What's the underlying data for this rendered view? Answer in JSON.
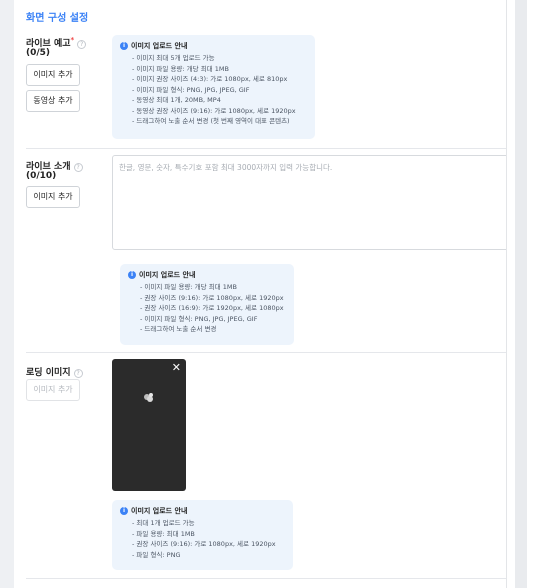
{
  "section_title": "화면 구성 설정",
  "live_preview": {
    "label": "라이브 예고",
    "required_mark": "*",
    "count": "(0/5)",
    "add_image_label": "이미지 추가",
    "add_video_label": "동영상 추가",
    "info": {
      "title": "이미지 업로드 안내",
      "items": [
        "이미지 최대 5개 업로드 가능",
        "이미지 파일 용량: 개당 최대 1MB",
        "이미지 권장 사이즈 (4:3): 가로 1080px, 세로 810px",
        "이미지 파일 형식: PNG, JPG, JPEG, GIF",
        "동영상 최대 1개, 20MB, MP4",
        "동영상 권장 사이즈 (9:16): 가로 1080px, 세로 1920px",
        "드래그하여 노출 순서 변경 (첫 번째 영역이 대표 콘텐츠)"
      ]
    }
  },
  "live_intro": {
    "label": "라이브 소개",
    "count": "(0/10)",
    "add_image_label": "이미지 추가",
    "textarea_placeholder": "한글, 영문, 숫자, 특수기호 포함 최대 3000자까지 입력 가능합니다.",
    "info": {
      "title": "이미지 업로드 안내",
      "items": [
        "이미지 파일 용량: 개당 최대 1MB",
        "권장 사이즈 (9:16): 가로 1080px, 세로 1920px",
        "권장 사이즈 (16:9): 가로 1920px, 세로 1080px",
        "이미지 파일 형식: PNG, JPG, JPEG, GIF",
        "드래그하여 노출 순서 변경"
      ]
    }
  },
  "loading_image": {
    "label": "로딩 이미지",
    "add_image_label": "이미지 추가",
    "close_symbol": "✕",
    "info": {
      "title": "이미지 업로드 안내",
      "items": [
        "최대 1개 업로드 가능",
        "파일 용량: 최대 1MB",
        "권장 사이즈 (9:16): 가로 1080px, 세로 1920px",
        "파일 형식: PNG"
      ]
    }
  },
  "colors": {
    "accent": "#3b82f6",
    "required": "#ef4444",
    "info_bg": "#edf4fc"
  }
}
